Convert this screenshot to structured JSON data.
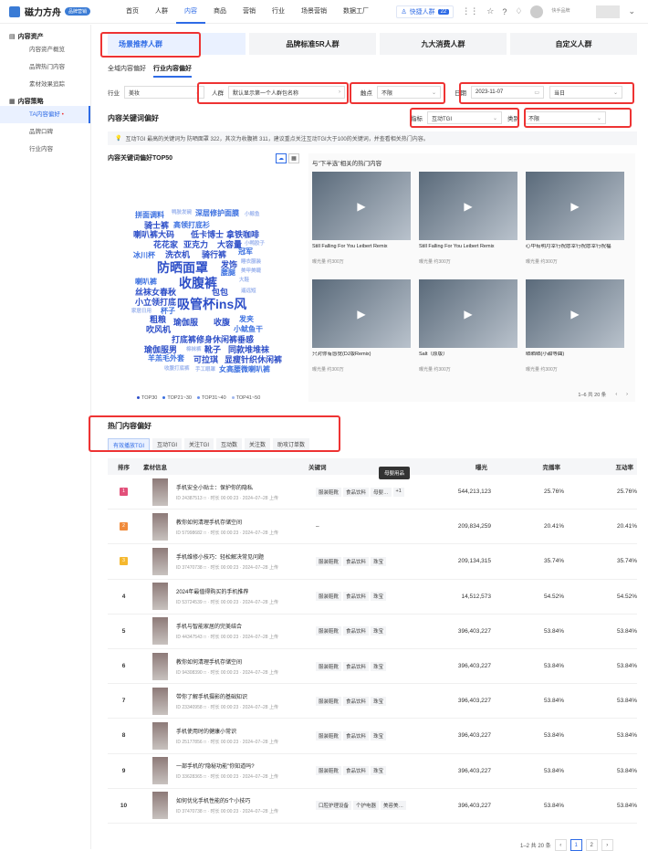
{
  "topbar": {
    "logo": "磁力方舟",
    "logo_badge": "品牌营销",
    "nav": [
      "首页",
      "人群",
      "内容",
      "商品",
      "营销",
      "行业",
      "场景营销",
      "数据工厂"
    ],
    "active_nav": 2,
    "quick_crowd": "快捷人群",
    "quick_count": "22",
    "user_name": "快手品牌"
  },
  "sidebar": {
    "group1": "内容资产",
    "items1": [
      "内容资产概览",
      "品牌热门内容",
      "素材效果追踪"
    ],
    "group2": "内容策略",
    "items2": [
      "TA内容偏好",
      "品牌口碑",
      "行业内容"
    ],
    "active_item2": 0
  },
  "main": {
    "tabs": [
      "场景推荐人群",
      "品牌标准5R人群",
      "九大消费人群",
      "自定义人群"
    ],
    "subtabs": [
      "全域内容偏好",
      "行业内容偏好"
    ],
    "filters": {
      "industry_label": "行业",
      "industry_value": "美妆",
      "crowd_label": "人群",
      "crowd_value": "默认显示第一个人群包名称",
      "touch_label": "触点",
      "touch_value": "不限",
      "date_label": "日期",
      "date_value": "2023-11-07",
      "date_range": "当日",
      "metric_label": "指标",
      "metric_value": "互动TGI",
      "category_label": "类别",
      "category_value": "不限"
    },
    "section_title": "内容关键词偏好",
    "notice": "互动TGI 最高的关键词为 防晒面罩 322，其次为收腹裤 311，建议重点关注互动TGI大于100的关键词，并查看相关热门内容。",
    "cloud_title": "内容关键词偏好TOP50",
    "cloud_legend": [
      "TOP30",
      "TOP21~30",
      "TOP31~40",
      "TOP41~50"
    ],
    "cloud_words": [
      {
        "t": "拼面调料",
        "tier": 1
      },
      {
        "t": "鸭肢发碗",
        "tier": 3
      },
      {
        "t": "深层修护面膜",
        "tier": 1
      },
      {
        "t": "小鲸鱼",
        "tier": 3
      },
      {
        "t": "骑士裤",
        "tier": 0
      },
      {
        "t": "高领打底衫",
        "tier": 1
      },
      {
        "t": "喇叭裤大码",
        "tier": 0
      },
      {
        "t": "低卡博士",
        "tier": 0
      },
      {
        "t": "拿铁咖啡",
        "tier": 0
      },
      {
        "t": "花花家",
        "tier": 0
      },
      {
        "t": "亚克力",
        "tier": 0
      },
      {
        "t": "大容量",
        "tier": 0
      },
      {
        "t": "小鸭胶子",
        "tier": 3
      },
      {
        "t": "冰川杯",
        "tier": 1
      },
      {
        "t": "洗衣机",
        "tier": 0
      },
      {
        "t": "骑行裤",
        "tier": 0
      },
      {
        "t": "冠军",
        "tier": 1
      },
      {
        "t": "防晒面罩",
        "tier": 0
      },
      {
        "t": "发饰",
        "tier": 0
      },
      {
        "t": "睡衣服装",
        "tier": 3
      },
      {
        "t": "腰腿",
        "tier": 1
      },
      {
        "t": "美甲美睫",
        "tier": 3
      },
      {
        "t": "喇叭裤",
        "tier": 1
      },
      {
        "t": "收腹裤",
        "tier": 0
      },
      {
        "t": "大鞋",
        "tier": 3
      },
      {
        "t": "丝袜女春秋",
        "tier": 0
      },
      {
        "t": "包包",
        "tier": 0
      },
      {
        "t": "遥远短",
        "tier": 3
      },
      {
        "t": "小立领打底",
        "tier": 0
      },
      {
        "t": "吸管杯ins风",
        "tier": 0
      },
      {
        "t": "杯子",
        "tier": 1
      },
      {
        "t": "家居日用",
        "tier": 3
      },
      {
        "t": "粗粮",
        "tier": 0
      },
      {
        "t": "瑜伽服",
        "tier": 0
      },
      {
        "t": "收腹",
        "tier": 0
      },
      {
        "t": "发夹",
        "tier": 1
      },
      {
        "t": "吹风机",
        "tier": 0
      },
      {
        "t": "小鱿鱼干",
        "tier": 1
      },
      {
        "t": "打底裤修身休闲裤垂感",
        "tier": 0
      },
      {
        "t": "瑜伽服男",
        "tier": 0
      },
      {
        "t": "棉袜裤",
        "tier": 3
      },
      {
        "t": "靴子",
        "tier": 0
      },
      {
        "t": "同款堆堆袜",
        "tier": 0
      },
      {
        "t": "羊羔毛外套",
        "tier": 1
      },
      {
        "t": "可拉琪",
        "tier": 0
      },
      {
        "t": "显瘦针织休闲裤",
        "tier": 0
      },
      {
        "t": "收腹打底裤",
        "tier": 3
      },
      {
        "t": "手工眼罩",
        "tier": 3
      },
      {
        "t": "女高腰微喇叭裤",
        "tier": 1
      }
    ],
    "hot_panel_title": "与\"下半选\"相关的热门内容",
    "videos": [
      {
        "title": "Still Falling For You Leibert Remix",
        "exposure": "曝光量 约300万"
      },
      {
        "title": "Still Falling For You Leibert Remix",
        "exposure": "曝光量 约300万"
      },
      {
        "title": "心中有明月幸行祝愿幸行祝愿幸行祝福",
        "exposure": "曝光量 约300万"
      },
      {
        "title": "只对你有感觉(DJ版Remix)",
        "exposure": "曝光量 约300万"
      },
      {
        "title": "Salt（原版）",
        "exposure": "曝光量 约300万"
      },
      {
        "title": "晒晒晒(小甜等曲)",
        "exposure": "曝光量 约300万"
      }
    ],
    "video_pager": "1–6 共 20 条",
    "hot_title": "热门内容偏好",
    "chips": [
      "有效播放TGI",
      "互动TGI",
      "关注TGI",
      "互动数",
      "关注数",
      "助攻订单数"
    ],
    "tooltip": "母婴用品",
    "table": {
      "headers": [
        "排序",
        "素材信息",
        "关键词",
        "曝光",
        "完播率",
        "互动率"
      ],
      "rows": [
        {
          "rank": "1",
          "title": "手机安全小贴士：保护你的隐私",
          "meta": "ID 24387513 □ · 时长 00:00:23 · 2024–07–28 上传",
          "kw": [
            "服装鞋靴",
            "食品饮料",
            "母婴…",
            "+1"
          ],
          "exp": "544,213,123",
          "comp": "25.76%",
          "inter": "25.76%"
        },
        {
          "rank": "2",
          "title": "教你如何清理手机存储空间",
          "meta": "ID 57998682 □ · 时长 00:00:23 · 2024–07–28 上传",
          "kw": [
            "–"
          ],
          "exp": "209,834,259",
          "comp": "20.41%",
          "inter": "20.41%"
        },
        {
          "rank": "3",
          "title": "手机维修小技巧：轻松解决常见问题",
          "meta": "ID 37470738 □ · 时长 00:00:23 · 2024–07–28 上传",
          "kw": [
            "服装鞋靴",
            "食品饮料",
            "珠宝"
          ],
          "exp": "209,134,315",
          "comp": "35.74%",
          "inter": "35.74%"
        },
        {
          "rank": "4",
          "title": "2024年最值得购买的手机推荐",
          "meta": "ID 53724539 □ · 时长 00:00:23 · 2024–07–28 上传",
          "kw": [
            "服装鞋靴",
            "食品饮料",
            "珠宝"
          ],
          "exp": "14,512,573",
          "comp": "54.52%",
          "inter": "54.52%"
        },
        {
          "rank": "5",
          "title": "手机与智能家居的完美结合",
          "meta": "ID 44347543 □ · 时长 00:00:23 · 2024–07–28 上传",
          "kw": [
            "服装鞋靴",
            "食品饮料",
            "珠宝"
          ],
          "exp": "396,403,227",
          "comp": "53.84%",
          "inter": "53.84%"
        },
        {
          "rank": "6",
          "title": "教你如何清理手机存储空间",
          "meta": "ID 94308390 □ · 时长 00:00:23 · 2024–07–28 上传",
          "kw": [
            "服装鞋靴",
            "食品饮料",
            "珠宝"
          ],
          "exp": "396,403,227",
          "comp": "53.84%",
          "inter": "53.84%"
        },
        {
          "rank": "7",
          "title": "带你了解手机摄影的基础知识",
          "meta": "ID 23340958 □ · 时长 00:00:23 · 2024–07–28 上传",
          "kw": [
            "服装鞋靴",
            "食品饮料",
            "珠宝"
          ],
          "exp": "396,403,227",
          "comp": "53.84%",
          "inter": "53.84%"
        },
        {
          "rank": "8",
          "title": "手机使用时的健康小常识",
          "meta": "ID 25177856 □ · 时长 00:00:23 · 2024–07–28 上传",
          "kw": [
            "服装鞋靴",
            "食品饮料",
            "珠宝"
          ],
          "exp": "396,403,227",
          "comp": "53.84%",
          "inter": "53.84%"
        },
        {
          "rank": "9",
          "title": "一部手机的\"隐秘功能\"你知道吗?",
          "meta": "ID 33628365 □ · 时长 00:00:23 · 2024–07–28 上传",
          "kw": [
            "服装鞋靴",
            "食品饮料",
            "珠宝"
          ],
          "exp": "396,403,227",
          "comp": "53.84%",
          "inter": "53.84%"
        },
        {
          "rank": "10",
          "title": "如何优化手机性能的5个小技巧",
          "meta": "ID 37470738 □ · 时长 00:00:23 · 2024–07–28 上传",
          "kw": [
            "口腔护理设备",
            "个护电器",
            "美容美…"
          ],
          "exp": "396,403,227",
          "comp": "53.84%",
          "inter": "53.84%"
        }
      ]
    },
    "pager": {
      "text": "1–2 共 20 条",
      "pages": [
        "1",
        "2"
      ],
      "current": "1"
    }
  },
  "colors": {
    "accent": "#2e6be6",
    "highlight_border": "#e33",
    "rank1": "#e2507a",
    "rank2": "#f08b3c",
    "rank3": "#f5b82e"
  }
}
